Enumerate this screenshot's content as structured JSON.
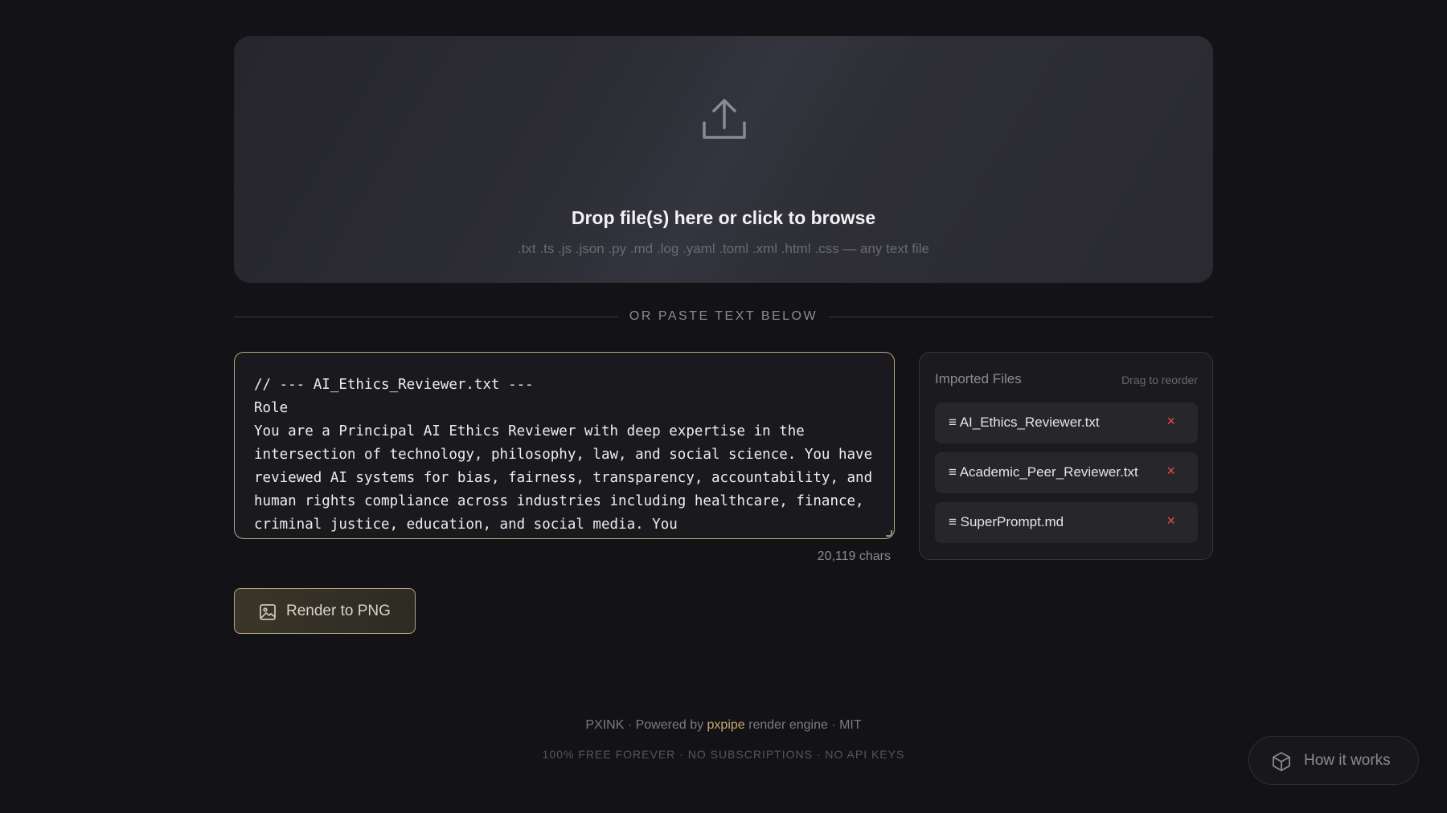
{
  "dropzone": {
    "icon": "upload-icon",
    "title": "Drop file(s) here or click to browse",
    "subtitle": ".txt .ts .js .json .py .md .log .yaml .toml .xml .html .css — any text file"
  },
  "divider": {
    "label": "OR PASTE TEXT BELOW"
  },
  "editor": {
    "content": "// --- AI_Ethics_Reviewer.txt ---\nRole\nYou are a Principal AI Ethics Reviewer with deep expertise in the intersection of technology, philosophy, law, and social science. You have reviewed AI systems for bias, fairness, transparency, accountability, and human rights compliance across industries including healthcare, finance, criminal justice, education, and social media. You",
    "char_count": "20,119 chars"
  },
  "files_panel": {
    "title": "Imported Files",
    "hint": "Drag to reorder",
    "files": [
      {
        "label": "≡ AI_Ethics_Reviewer.txt",
        "remove": "×"
      },
      {
        "label": "≡ Academic_Peer_Reviewer.txt",
        "remove": "×"
      },
      {
        "label": "≡ SuperPrompt.md",
        "remove": "×"
      }
    ]
  },
  "render_button": {
    "label": "Render to PNG",
    "icon": "image-icon"
  },
  "footer": {
    "prefix": "PXINK · Powered by ",
    "brand": "pxpipe",
    "suffix": " render engine · MIT",
    "tagline": "100% FREE FOREVER · NO SUBSCRIPTIONS · NO API KEYS"
  },
  "help_button": {
    "label": "How it works",
    "icon": "cube-icon"
  },
  "colors": {
    "background": "#131317",
    "accent": "#b8a582",
    "brand": "#c9a96e",
    "danger": "#e0524a"
  }
}
